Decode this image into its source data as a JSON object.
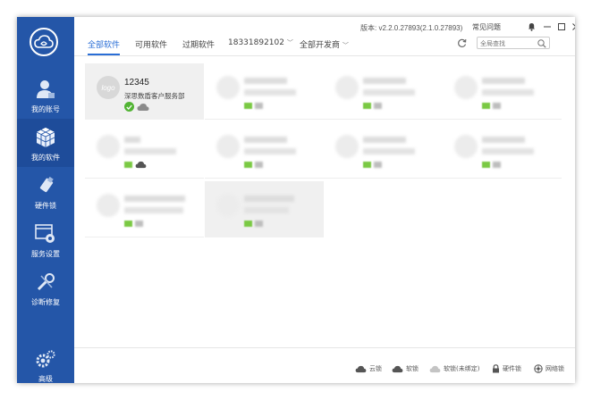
{
  "window": {
    "version": "版本: v2.2.0.27893(2.1.0.27893)",
    "faq": "常见问题"
  },
  "sidebar": {
    "items": [
      {
        "label": "我的账号",
        "icon": "user-icon"
      },
      {
        "label": "我的软件",
        "icon": "software-cube-icon",
        "active": true
      },
      {
        "label": "硬件锁",
        "icon": "hardware-lock-icon"
      },
      {
        "label": "服务设置",
        "icon": "service-settings-icon"
      },
      {
        "label": "诊断修复",
        "icon": "diagnose-repair-icon"
      },
      {
        "label": "高级",
        "icon": "gear-icon"
      }
    ]
  },
  "tabs": [
    {
      "label": "全部软件",
      "active": true
    },
    {
      "label": "可用软件"
    },
    {
      "label": "过期软件"
    },
    {
      "label": "18331892102"
    },
    {
      "label": "全部开发商"
    }
  ],
  "search": {
    "placeholder": "全局查找"
  },
  "cards": [
    {
      "name": "12345",
      "desc": "深思数盾客户服务部",
      "logo_text": "logo"
    }
  ],
  "legend": [
    {
      "label": "云锁",
      "icon": "cloud-lock-icon"
    },
    {
      "label": "软锁",
      "icon": "soft-lock-icon"
    },
    {
      "label": "软锁(未绑定)",
      "icon": "soft-lock-unbound-icon"
    },
    {
      "label": "硬件锁",
      "icon": "hardware-lock-icon"
    },
    {
      "label": "网络锁",
      "icon": "network-lock-icon"
    }
  ],
  "colors": {
    "sidebar": "#2456a8",
    "accent": "#2a6ed6",
    "status_ok": "#52b434"
  }
}
